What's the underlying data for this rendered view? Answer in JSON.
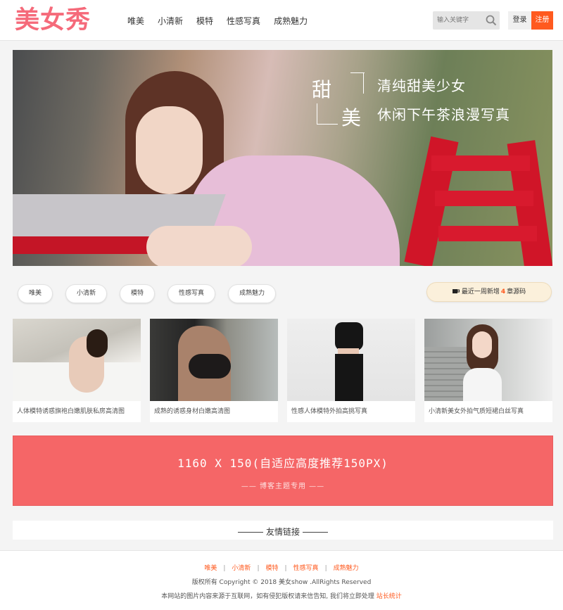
{
  "header": {
    "logo": "美女秀",
    "nav": [
      "唯美",
      "小清新",
      "模特",
      "性感写真",
      "成熟魅力"
    ],
    "search_placeholder": "输入关键字",
    "login": "登录",
    "register": "注册"
  },
  "banner": {
    "big1": "甜",
    "big2": "美",
    "line1": "清纯甜美少女",
    "line2": "休闲下午茶浪漫写真"
  },
  "tags": [
    "唯美",
    "小清新",
    "模特",
    "性感写真",
    "成熟魅力"
  ],
  "notice": {
    "prefix": "最近一周新增",
    "count": "4",
    "suffix": "章源码",
    "icon": "coffee-cup-icon"
  },
  "cards": [
    {
      "caption": "人体模特诱惑旗袍白嫩肌肤私房高清图"
    },
    {
      "caption": "成熟的诱惑身材白嫩高清图"
    },
    {
      "caption": "性感人体模特外拍高挑写真"
    },
    {
      "caption": "小清新美女外拍气质短裙白丝写真"
    }
  ],
  "ad": {
    "title": "1160 X 150(自适应高度推荐150PX)",
    "subtitle": "—— 博客主题专用 ——"
  },
  "links": {
    "title": "友情链接"
  },
  "footer": {
    "nav": [
      "唯美",
      "小清新",
      "模特",
      "性感写真",
      "成熟魅力"
    ],
    "copyright": "版权所有 Copyright © 2018 美女show .AllRights Reserved",
    "note": "本网站的图片内容来源于互联网，如有侵犯版权请来信告知, 我们将立即处理",
    "stat": "站长统计"
  },
  "colors": {
    "brand": "#f56a7a",
    "accent": "#ff5a1f",
    "ad_bg": "#f56667"
  }
}
